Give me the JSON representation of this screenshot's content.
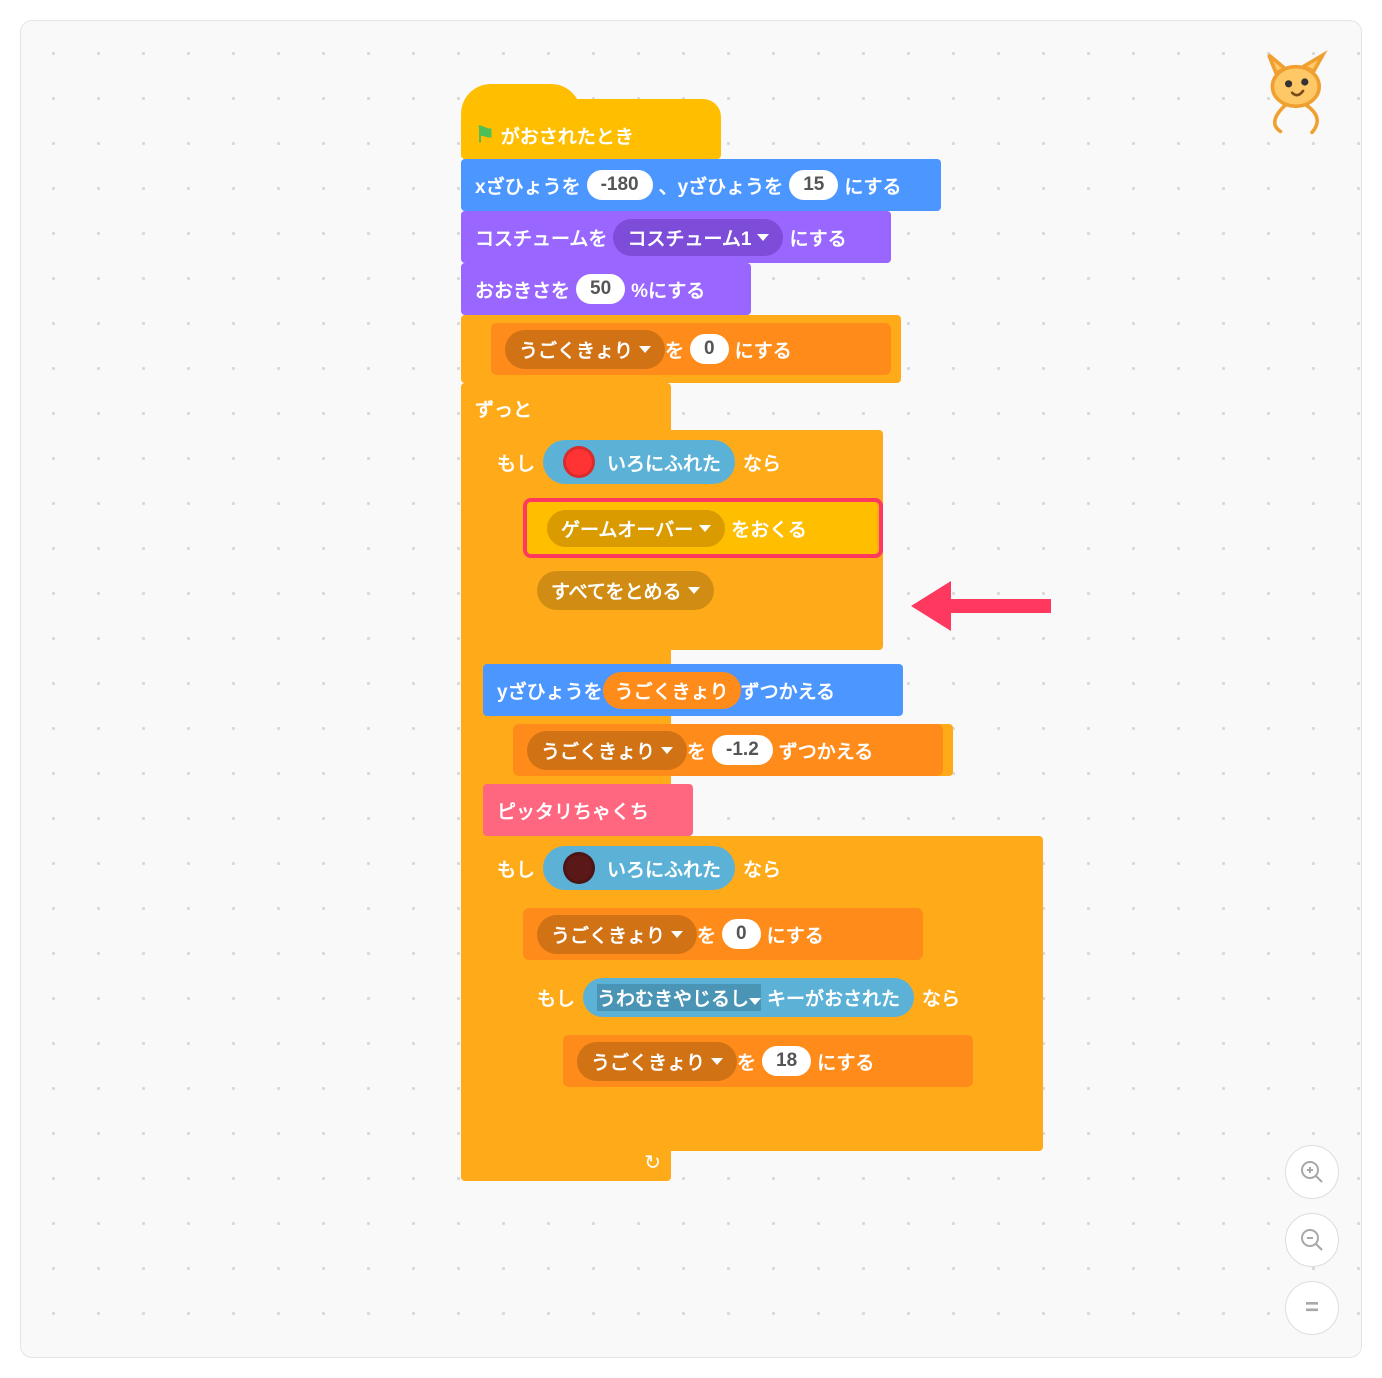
{
  "hat": {
    "label": "がおされたとき"
  },
  "goto": {
    "pre": "xざひょうを",
    "x": "-180",
    "mid": "、yざひょうを",
    "y": "15",
    "post": "にする"
  },
  "costume": {
    "pre": "コスチュームを",
    "opt": "コスチューム1",
    "post": "にする"
  },
  "size": {
    "pre": "おおきさを",
    "val": "50",
    "post": "%にする"
  },
  "setvar1": {
    "var": "うごくきょり",
    "mid": "を",
    "val": "0",
    "post": "にする"
  },
  "forever": "ずっと",
  "if1": {
    "pre": "もし",
    "cond": "いろにふれた",
    "post": "なら",
    "color": "#ff3333"
  },
  "broadcast": {
    "opt": "ゲームオーバー",
    "post": "をおくる"
  },
  "stop": {
    "opt": "すべてをとめる"
  },
  "changey": {
    "pre": "yざひょうを",
    "var": "うごくきょり",
    "post": "ずつかえる"
  },
  "changevar": {
    "var": "うごくきょり",
    "mid": "を",
    "val": "-1.2",
    "post": "ずつかえる"
  },
  "custom": "ピッタリちゃくち",
  "if2": {
    "pre": "もし",
    "cond": "いろにふれた",
    "post": "なら",
    "color": "#6b2020"
  },
  "setvar2": {
    "var": "うごくきょり",
    "mid": "を",
    "val": "0",
    "post": "にする"
  },
  "if3": {
    "pre": "もし",
    "key": "うわむきやじるし",
    "cond": "キーがおされた",
    "post": "なら"
  },
  "setvar3": {
    "var": "うごくきょり",
    "mid": "を",
    "val": "18",
    "post": "にする"
  },
  "ctrl": {
    "in": "+",
    "out": "−",
    "eq": "="
  }
}
